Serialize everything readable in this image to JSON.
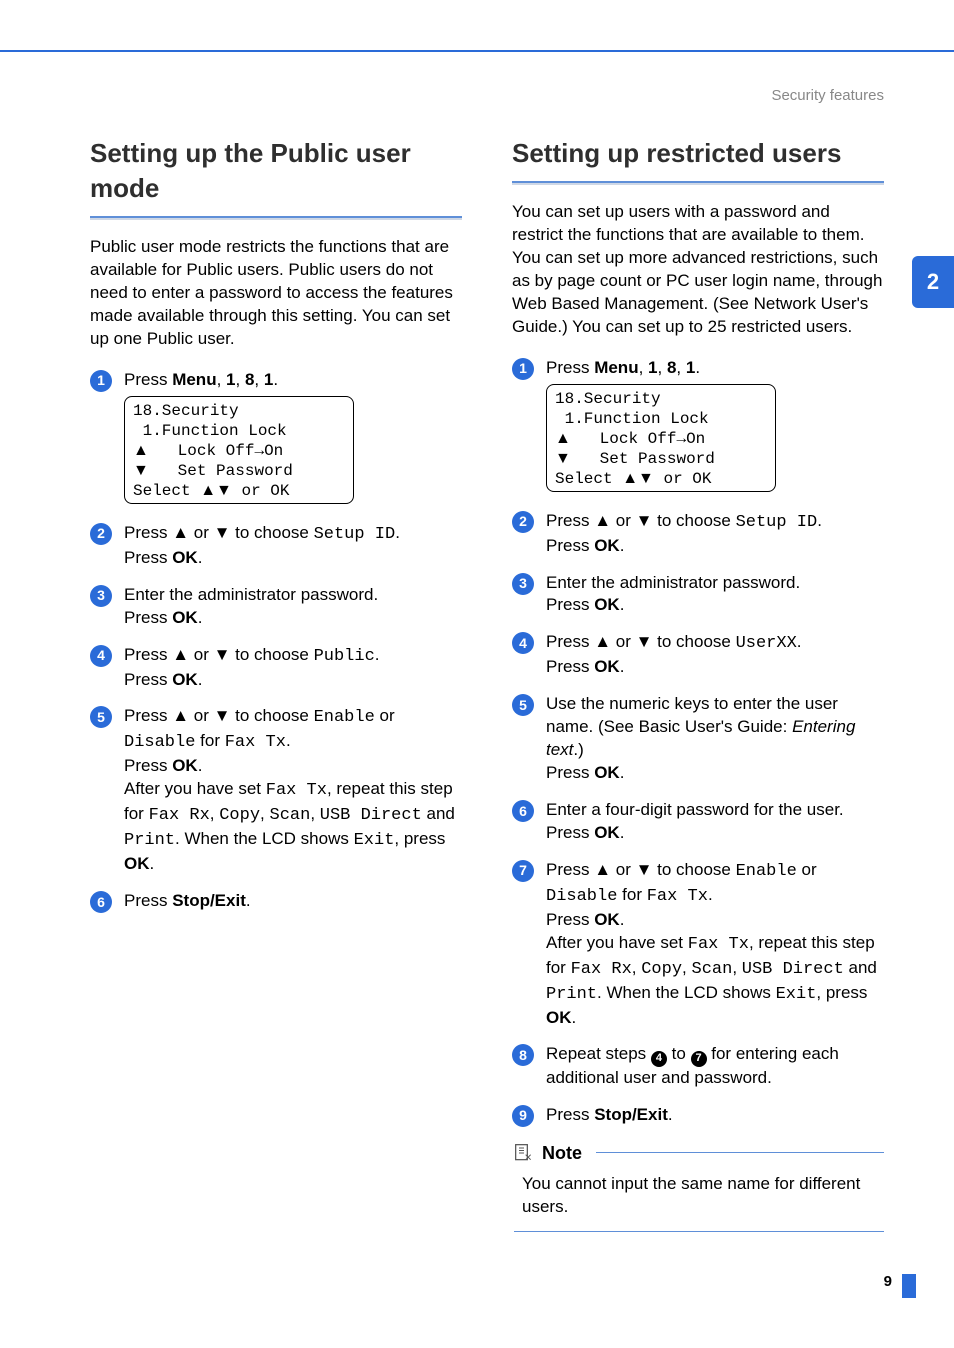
{
  "breadcrumb": "Security features",
  "chapter_tab": "2",
  "page_number": "9",
  "left": {
    "heading": "Setting up the Public user mode",
    "intro": "Public user mode restricts the functions that are available for Public users. Public users do not need to enter a password to access the features made available through this setting. You can set up one Public user.",
    "lcd": {
      "l1": "18.Security",
      "l2": " 1.Function Lock",
      "l3_arrow": "a",
      "l3_text": "   Lock Off",
      "l3_arrowR": "i",
      "l3_text2": "On",
      "l4_arrow": "b",
      "l4_text": "   Set Password",
      "l5a": "Select ",
      "l5_arrows": "ab",
      "l5b": " or OK"
    },
    "steps": {
      "s1a": "Press ",
      "s1_menu": "Menu",
      "s1b": ", ",
      "s1_1a": "1",
      "s1c": ", ",
      "s1_8": "8",
      "s1d": ", ",
      "s1_1b": "1",
      "s1e": ".",
      "s2a": "Press ",
      "s2up": "a",
      "s2or": " or ",
      "s2dn": "b",
      "s2b": " to choose ",
      "s2opt": "Setup ID",
      "s2c": ".",
      "s2d": "Press ",
      "s2ok": "OK",
      "s2e": ".",
      "s3a": "Enter the administrator password.",
      "s3b": "Press ",
      "s3ok": "OK",
      "s3c": ".",
      "s4a": "Press ",
      "s4up": "a",
      "s4or": " or ",
      "s4dn": "b",
      "s4b": " to choose ",
      "s4opt": "Public",
      "s4c": ".",
      "s4d": "Press ",
      "s4ok": "OK",
      "s4e": ".",
      "s5a": "Press ",
      "s5up": "a",
      "s5or": " or ",
      "s5dn": "b",
      "s5b": " to choose ",
      "s5en": "Enable",
      "s5or2": " or ",
      "s5dis": "Disable",
      "s5for": " for ",
      "s5fax": "Fax Tx",
      "s5c": ".",
      "s5d": "Press ",
      "s5ok": "OK",
      "s5e": ".",
      "s5f": "After you have set ",
      "s5faxtx": "Fax Tx",
      "s5g": ", repeat this step for ",
      "s5rx": "Fax Rx",
      "s5h": ", ",
      "s5cp": "Copy",
      "s5i": ", ",
      "s5sc": "Scan",
      "s5j": ", ",
      "s5usb": "USB Direct",
      "s5k": " and ",
      "s5pr": "Print",
      "s5l": ". When the LCD shows ",
      "s5ex": "Exit",
      "s5m": ", press ",
      "s5ok2": "OK",
      "s5n": ".",
      "s6a": "Press ",
      "s6b": "Stop/Exit",
      "s6c": "."
    }
  },
  "right": {
    "heading": "Setting up restricted users",
    "intro": "You can set up users with a password and restrict the functions that are available to them. You can set up more advanced restrictions, such as by page count or PC user login name, through Web Based Management. (See Network User's Guide.) You can set up to 25 restricted users.",
    "lcd": {
      "l1": "18.Security",
      "l2": " 1.Function Lock",
      "l3_arrow": "a",
      "l3_text": "   Lock Off",
      "l3_arrowR": "i",
      "l3_text2": "On",
      "l4_arrow": "b",
      "l4_text": "   Set Password",
      "l5a": "Select ",
      "l5_arrows": "ab",
      "l5b": " or OK"
    },
    "steps": {
      "s1a": "Press ",
      "s1_menu": "Menu",
      "s1b": ", ",
      "s1_1a": "1",
      "s1c": ", ",
      "s1_8": "8",
      "s1d": ", ",
      "s1_1b": "1",
      "s1e": ".",
      "s2a": "Press ",
      "s2up": "a",
      "s2or": " or ",
      "s2dn": "b",
      "s2b": " to choose ",
      "s2opt": "Setup ID",
      "s2c": ".",
      "s2d": "Press ",
      "s2ok": "OK",
      "s2e": ".",
      "s3a": "Enter the administrator password.",
      "s3b": "Press ",
      "s3ok": "OK",
      "s3c": ".",
      "s4a": "Press ",
      "s4up": "a",
      "s4or": " or ",
      "s4dn": "b",
      "s4b": " to choose ",
      "s4opt": "UserXX",
      "s4c": ".",
      "s4d": "Press ",
      "s4ok": "OK",
      "s4e": ".",
      "s5a": "Use the numeric keys to enter the user name. (See Basic User's Guide: ",
      "s5em": "Entering text",
      "s5b": ".)",
      "s5c": "Press ",
      "s5ok": "OK",
      "s5d": ".",
      "s6a": "Enter a four-digit password for the user.",
      "s6b": "Press ",
      "s6ok": "OK",
      "s6c": ".",
      "s7a": "Press ",
      "s7up": "a",
      "s7or": " or ",
      "s7dn": "b",
      "s7b": " to choose ",
      "s7en": "Enable",
      "s7or2": " or ",
      "s7dis": "Disable",
      "s7for": " for ",
      "s7fax": "Fax Tx",
      "s7c": ".",
      "s7d": "Press ",
      "s7ok": "OK",
      "s7e": ".",
      "s7f": "After you have set ",
      "s7faxtx": "Fax Tx",
      "s7g": ", repeat this step for ",
      "s7rx": "Fax Rx",
      "s7h": ", ",
      "s7cp": "Copy",
      "s7i": ", ",
      "s7sc": "Scan",
      "s7j": ", ",
      "s7usb": "USB Direct",
      "s7k": " and ",
      "s7pr": "Print",
      "s7l": ". When the LCD shows ",
      "s7ex": "Exit",
      "s7m": ", press ",
      "s7ok2": "OK",
      "s7n": ".",
      "s8a": "Repeat steps ",
      "s8n4": "4",
      "s8b": " to ",
      "s8n7": "7",
      "s8c": " for entering each additional user and password.",
      "s9a": "Press ",
      "s9b": "Stop/Exit",
      "s9c": "."
    },
    "note": {
      "title": "Note",
      "body": "You cannot input the same name for different users."
    }
  }
}
